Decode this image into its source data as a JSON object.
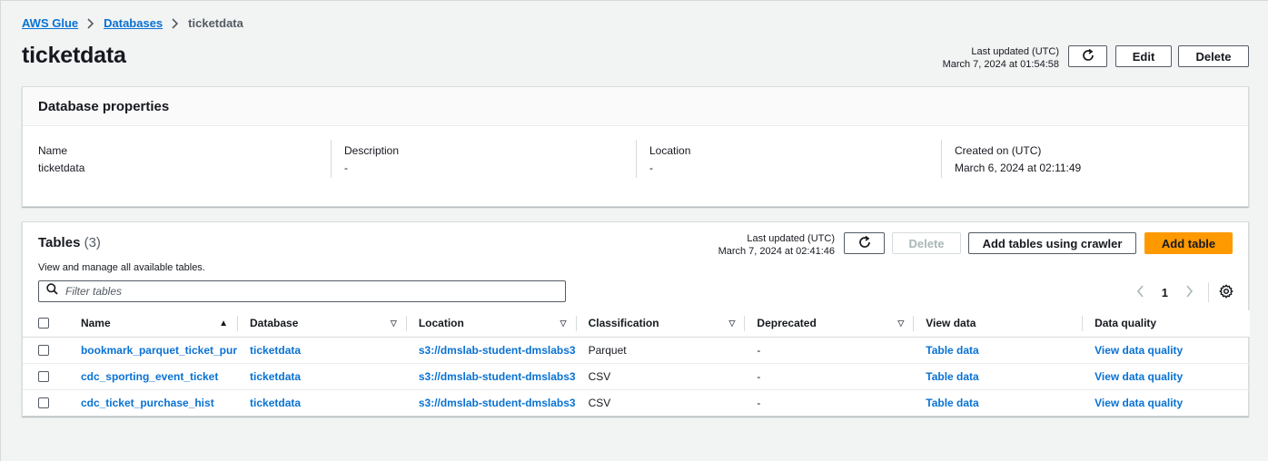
{
  "breadcrumb": {
    "root": "AWS Glue",
    "databases": "Databases",
    "current": "ticketdata"
  },
  "header": {
    "title": "ticketdata",
    "last_updated_label": "Last updated (UTC)",
    "last_updated_value": "March 7, 2024 at 01:54:58",
    "edit_label": "Edit",
    "delete_label": "Delete"
  },
  "properties": {
    "title": "Database properties",
    "items": [
      {
        "label": "Name",
        "value": "ticketdata"
      },
      {
        "label": "Description",
        "value": "-"
      },
      {
        "label": "Location",
        "value": "-"
      },
      {
        "label": "Created on (UTC)",
        "value": "March 6, 2024 at 02:11:49"
      }
    ]
  },
  "tables": {
    "title": "Tables",
    "count": "(3)",
    "description": "View and manage all available tables.",
    "last_updated_label": "Last updated (UTC)",
    "last_updated_value": "March 7, 2024 at 02:41:46",
    "delete_label": "Delete",
    "crawler_label": "Add tables using crawler",
    "add_label": "Add table",
    "filter_placeholder": "Filter tables",
    "page": "1",
    "columns": [
      "Name",
      "Database",
      "Location",
      "Classification",
      "Deprecated",
      "View data",
      "Data quality"
    ],
    "rows": [
      {
        "name": "bookmark_parquet_ticket_pur",
        "database": "ticketdata",
        "location": "s3://dmslab-student-dmslabs3",
        "classification": "Parquet",
        "deprecated": "-",
        "view": "Table data",
        "quality": "View data quality"
      },
      {
        "name": "cdc_sporting_event_ticket",
        "database": "ticketdata",
        "location": "s3://dmslab-student-dmslabs3",
        "classification": "CSV",
        "deprecated": "-",
        "view": "Table data",
        "quality": "View data quality"
      },
      {
        "name": "cdc_ticket_purchase_hist",
        "database": "ticketdata",
        "location": "s3://dmslab-student-dmslabs3",
        "classification": "CSV",
        "deprecated": "-",
        "view": "Table data",
        "quality": "View data quality"
      }
    ]
  },
  "colors": {
    "link": "#0972d3",
    "primary": "#ff9900",
    "background": "#f2f3f3"
  }
}
